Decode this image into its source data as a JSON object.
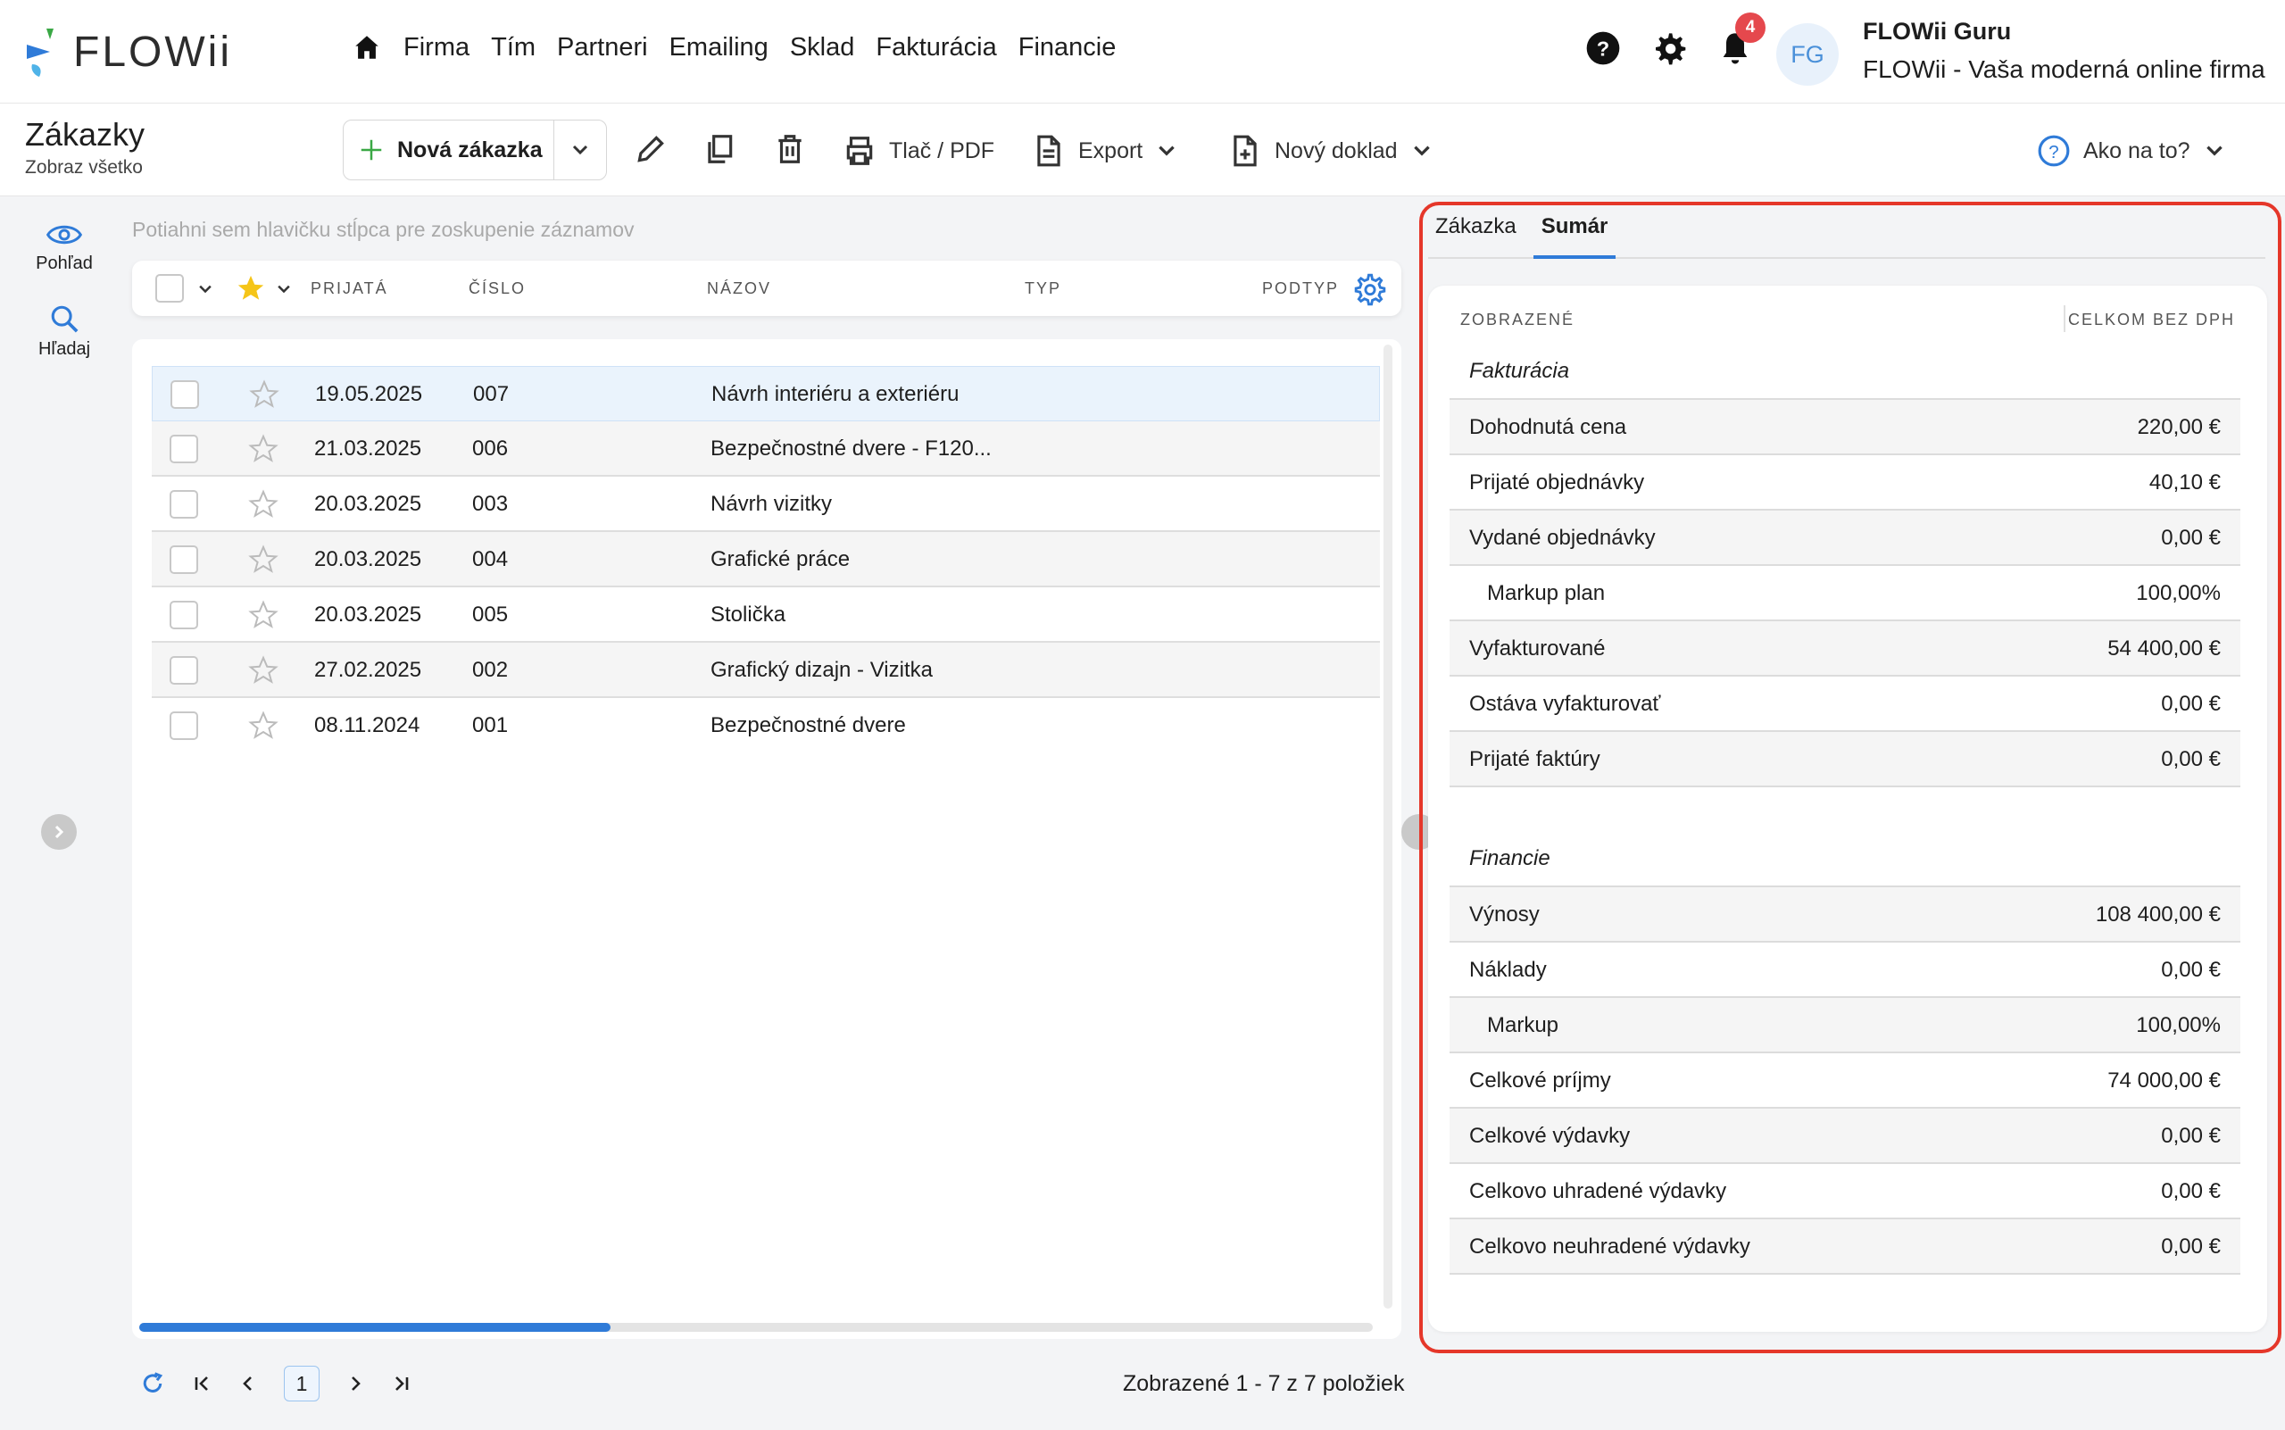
{
  "app": {
    "logo_text": "FLOWii"
  },
  "nav": {
    "items": [
      "Firma",
      "Tím",
      "Partneri",
      "Emailing",
      "Sklad",
      "Fakturácia",
      "Financie"
    ]
  },
  "notifications": {
    "count": "4"
  },
  "user": {
    "initials": "FG",
    "name": "FLOWii Guru",
    "org": "FLOWii - Vaša moderná online firma"
  },
  "page": {
    "title": "Zákazky",
    "subtitle": "Zobraz všetko"
  },
  "toolbar": {
    "new_label": "Nová zákazka",
    "print_label": "Tlač / PDF",
    "export_label": "Export",
    "new_doc_label": "Nový doklad",
    "help_label": "Ako na to?"
  },
  "rail": {
    "view_label": "Pohľad",
    "search_label": "Hľadaj"
  },
  "grid": {
    "group_hint": "Potiahni sem hlavičku stĺpca pre zoskupenie záznamov",
    "columns": {
      "received": "PRIJATÁ",
      "number": "ČÍSLO",
      "name": "NÁZOV",
      "type": "TYP",
      "subtype": "PODTYP"
    },
    "rows": [
      {
        "date": "19.05.2025",
        "number": "007",
        "name": "Návrh interiéru a exteriéru"
      },
      {
        "date": "21.03.2025",
        "number": "006",
        "name": "Bezpečnostné dvere - F120..."
      },
      {
        "date": "20.03.2025",
        "number": "003",
        "name": "Návrh vizitky"
      },
      {
        "date": "20.03.2025",
        "number": "004",
        "name": "Grafické práce"
      },
      {
        "date": "20.03.2025",
        "number": "005",
        "name": "Stolička"
      },
      {
        "date": "27.02.2025",
        "number": "002",
        "name": "Grafický dizajn - Vizitka"
      },
      {
        "date": "08.11.2024",
        "number": "001",
        "name": "Bezpečnostné dvere"
      }
    ]
  },
  "pager": {
    "page": "1",
    "info": "Zobrazené 1 - 7 z 7 položiek"
  },
  "summary": {
    "tabs": [
      "Zákazka",
      "Sumár"
    ],
    "head_left": "ZOBRAZENÉ",
    "head_right": "CELKOM BEZ DPH",
    "section1": "Fakturácia",
    "rows1": [
      {
        "label": "Dohodnutá cena",
        "value": "220,00 €"
      },
      {
        "label": "Prijaté objednávky",
        "value": "40,10 €"
      },
      {
        "label": "Vydané objednávky",
        "value": "0,00 €"
      },
      {
        "label": "Markup plan",
        "value": "100,00%"
      },
      {
        "label": "Vyfakturované",
        "value": "54 400,00 €"
      },
      {
        "label": "Ostáva vyfakturovať",
        "value": "0,00 €"
      },
      {
        "label": "Prijaté faktúry",
        "value": "0,00 €"
      }
    ],
    "section2": "Financie",
    "rows2": [
      {
        "label": "Výnosy",
        "value": "108 400,00 €"
      },
      {
        "label": "Náklady",
        "value": "0,00 €"
      },
      {
        "label": "Markup",
        "value": "100,00%"
      },
      {
        "label": "Celkové príjmy",
        "value": "74 000,00 €"
      },
      {
        "label": "Celkové výdavky",
        "value": "0,00 €"
      },
      {
        "label": "Celkovo uhradené výdavky",
        "value": "0,00 €"
      },
      {
        "label": "Celkovo neuhradené výdavky",
        "value": "0,00 €"
      }
    ]
  },
  "colors": {
    "accent": "#2f7bd8",
    "highlight": "#e5372a",
    "star": "#f5c518",
    "add": "#3aa845"
  },
  "icons": [
    "home-icon",
    "help-icon",
    "gear-icon",
    "bell-icon",
    "plus-icon",
    "chevron-down-icon",
    "pencil-icon",
    "copy-icon",
    "trash-icon",
    "printer-icon",
    "document-icon",
    "new-document-icon",
    "question-circle-icon",
    "eye-icon",
    "search-icon",
    "star-icon",
    "settings-cog-icon",
    "refresh-icon",
    "first-page-icon",
    "prev-page-icon",
    "next-page-icon",
    "last-page-icon"
  ]
}
